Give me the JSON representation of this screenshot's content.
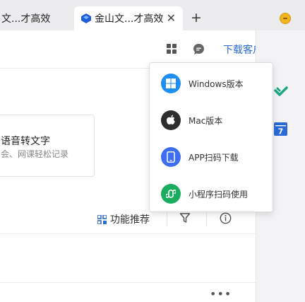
{
  "tabs": [
    {
      "title": "文...才高效",
      "active": false
    },
    {
      "title": "金山文...才高效",
      "active": true,
      "close": "✕"
    }
  ],
  "new_tab_label": "+",
  "header": {
    "download_label": "下载客户端"
  },
  "card": {
    "title": "语音转文字",
    "subtitle": "会、网课轻松记录"
  },
  "toolbar": {
    "recommend_label": "功能推荐"
  },
  "more_label": "•••",
  "dropdown": {
    "items": [
      {
        "label": "Windows版本",
        "icon": "windows-icon",
        "color": "#1f8ef1"
      },
      {
        "label": "Mac版本",
        "icon": "apple-icon",
        "color": "#2d2d2d"
      },
      {
        "label": "APP扫码下载",
        "icon": "phone-icon",
        "color": "#3d6df0"
      },
      {
        "label": "小程序扫码使用",
        "icon": "miniprogram-icon",
        "color": "#1aad5e"
      }
    ]
  },
  "side_panel": {
    "calendar_day": "7"
  },
  "colors": {
    "accent": "#2a6ad8",
    "window_button": "#f0b51c"
  }
}
